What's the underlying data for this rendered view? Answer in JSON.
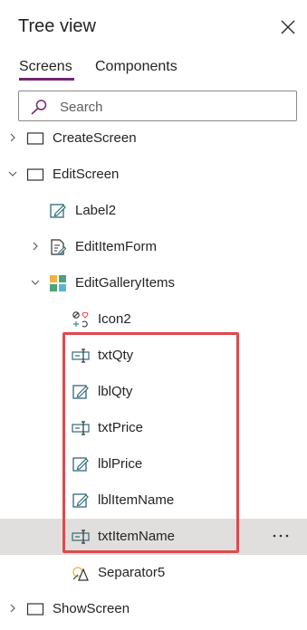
{
  "panel": {
    "title": "Tree view"
  },
  "tabs": [
    {
      "label": "Screens",
      "active": true
    },
    {
      "label": "Components",
      "active": false
    }
  ],
  "search": {
    "placeholder": "Search"
  },
  "tree": [
    {
      "label": "CreateScreen",
      "icon": "screen-icon",
      "expander": "chevron-right"
    },
    {
      "label": "EditScreen",
      "icon": "screen-icon",
      "expander": "chevron-down"
    },
    {
      "label": "Label2",
      "icon": "label-icon"
    },
    {
      "label": "EditItemForm",
      "icon": "form-icon",
      "expander": "chevron-right"
    },
    {
      "label": "EditGalleryItems",
      "icon": "gallery-icon",
      "expander": "chevron-down"
    },
    {
      "label": "Icon2",
      "icon": "icon-control-icon"
    },
    {
      "label": "txtQty",
      "icon": "text-input-icon"
    },
    {
      "label": "lblQty",
      "icon": "label-icon"
    },
    {
      "label": "txtPrice",
      "icon": "text-input-icon"
    },
    {
      "label": "lblPrice",
      "icon": "label-icon"
    },
    {
      "label": "lblItemName",
      "icon": "label-icon"
    },
    {
      "label": "txtItemName",
      "icon": "text-input-icon",
      "selected": true,
      "more": "..."
    },
    {
      "label": "Separator5",
      "icon": "shape-icon"
    },
    {
      "label": "ShowScreen",
      "icon": "screen-icon",
      "expander": "chevron-right"
    }
  ],
  "colors": {
    "accent": "#742774",
    "highlight_border": "#e0484d",
    "selected_row": "#e1dfdd"
  }
}
